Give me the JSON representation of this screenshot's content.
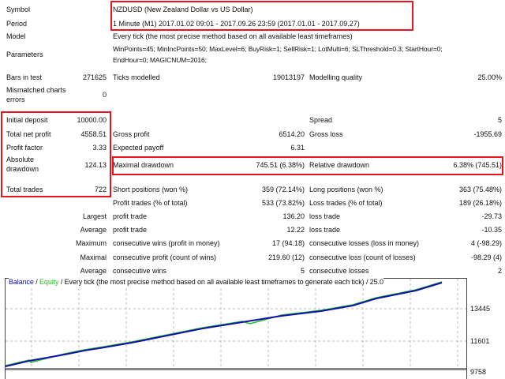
{
  "header": {
    "symbol_label": "Symbol",
    "symbol": "NZDUSD (New Zealand Dollar vs US Dollar)",
    "period_label": "Period",
    "period": "1 Minute (M1) 2017.01.02 09:01 - 2017.09.26 23:59 (2017.01.01 - 2017.09.27)",
    "model_label": "Model",
    "model": "Every tick (the most precise method based on all available least timeframes)",
    "params_label": "Parameters",
    "params_line1": "WinPoints=45; MinIncPoints=50; MaxLevel=6; BuyRisk=1; SellRisk=1; LotMulti=6; SLThreshold=0.3; StartHour=0;",
    "params_line2": "EndHour=0; MAGICNUM=2016;"
  },
  "stats": {
    "bars_label": "Bars in test",
    "bars": "271625",
    "ticks_label": "Ticks modelled",
    "ticks": "19013197",
    "quality_label": "Modelling quality",
    "quality": "25.00%",
    "mismatch_label1": "Mismatched charts",
    "mismatch_label2": "errors",
    "mismatch": "0",
    "deposit_label": "Initial deposit",
    "deposit": "10000.00",
    "spread_label": "Spread",
    "spread": "5",
    "net_label": "Total net profit",
    "net": "4558.51",
    "gross_profit_label": "Gross profit",
    "gross_profit": "6514.20",
    "gross_loss_label": "Gross loss",
    "gross_loss": "-1955.69",
    "pf_label": "Profit factor",
    "pf": "3.33",
    "payoff_label": "Expected payoff",
    "payoff": "6.31",
    "abs_dd_label1": "Absolute",
    "abs_dd_label2": "drawdown",
    "abs_dd": "124.13",
    "max_dd_label": "Maximal drawdown",
    "max_dd": "745.51 (6.38%)",
    "rel_dd_label": "Relative drawdown",
    "rel_dd": "6.38% (745.51)",
    "trades_label": "Total trades",
    "trades": "722",
    "short_label": "Short positions (won %)",
    "short": "359 (72.14%)",
    "long_label": "Long positions (won %)",
    "long": "363 (75.48%)",
    "ptrades_label": "Profit trades (% of total)",
    "ptrades": "533 (73.82%)",
    "ltrades_label": "Loss trades (% of total)",
    "ltrades": "189 (26.18%)",
    "largest_label": "Largest",
    "largest_p_label": "profit trade",
    "largest_p": "136.20",
    "largest_l_label": "loss trade",
    "largest_l": "-29.73",
    "average_label": "Average",
    "average_p_label": "profit trade",
    "average_p": "12.22",
    "average_l_label": "loss trade",
    "average_l": "-10.35",
    "maximum_label": "Maximum",
    "max_cw_label": "consecutive wins (profit in money)",
    "max_cw": "17 (94.18)",
    "max_cl_label": "consecutive losses (loss in money)",
    "max_cl": "4 (-98.29)",
    "maximal_label": "Maximal",
    "mcp_label": "consecutive profit (count of wins)",
    "mcp": "219.60 (12)",
    "mcl_label": "consecutive loss (count of losses)",
    "mcl": "-98.29 (4)",
    "avgc_label": "Average",
    "acw_label": "consecutive wins",
    "acw": "5",
    "acl_label": "consecutive losses",
    "acl": "2"
  },
  "chart": {
    "legend_balance": "Balance",
    "sep": " / ",
    "legend_equity": "Equity",
    "legend_rest": " / Every tick (the most precise method based on all available least timeframes to generate each tick) / 25.0",
    "y_ticks": [
      "13445",
      "11601",
      "9758"
    ],
    "balance_color": "#1010b0",
    "equity_color": "#20c020"
  }
}
